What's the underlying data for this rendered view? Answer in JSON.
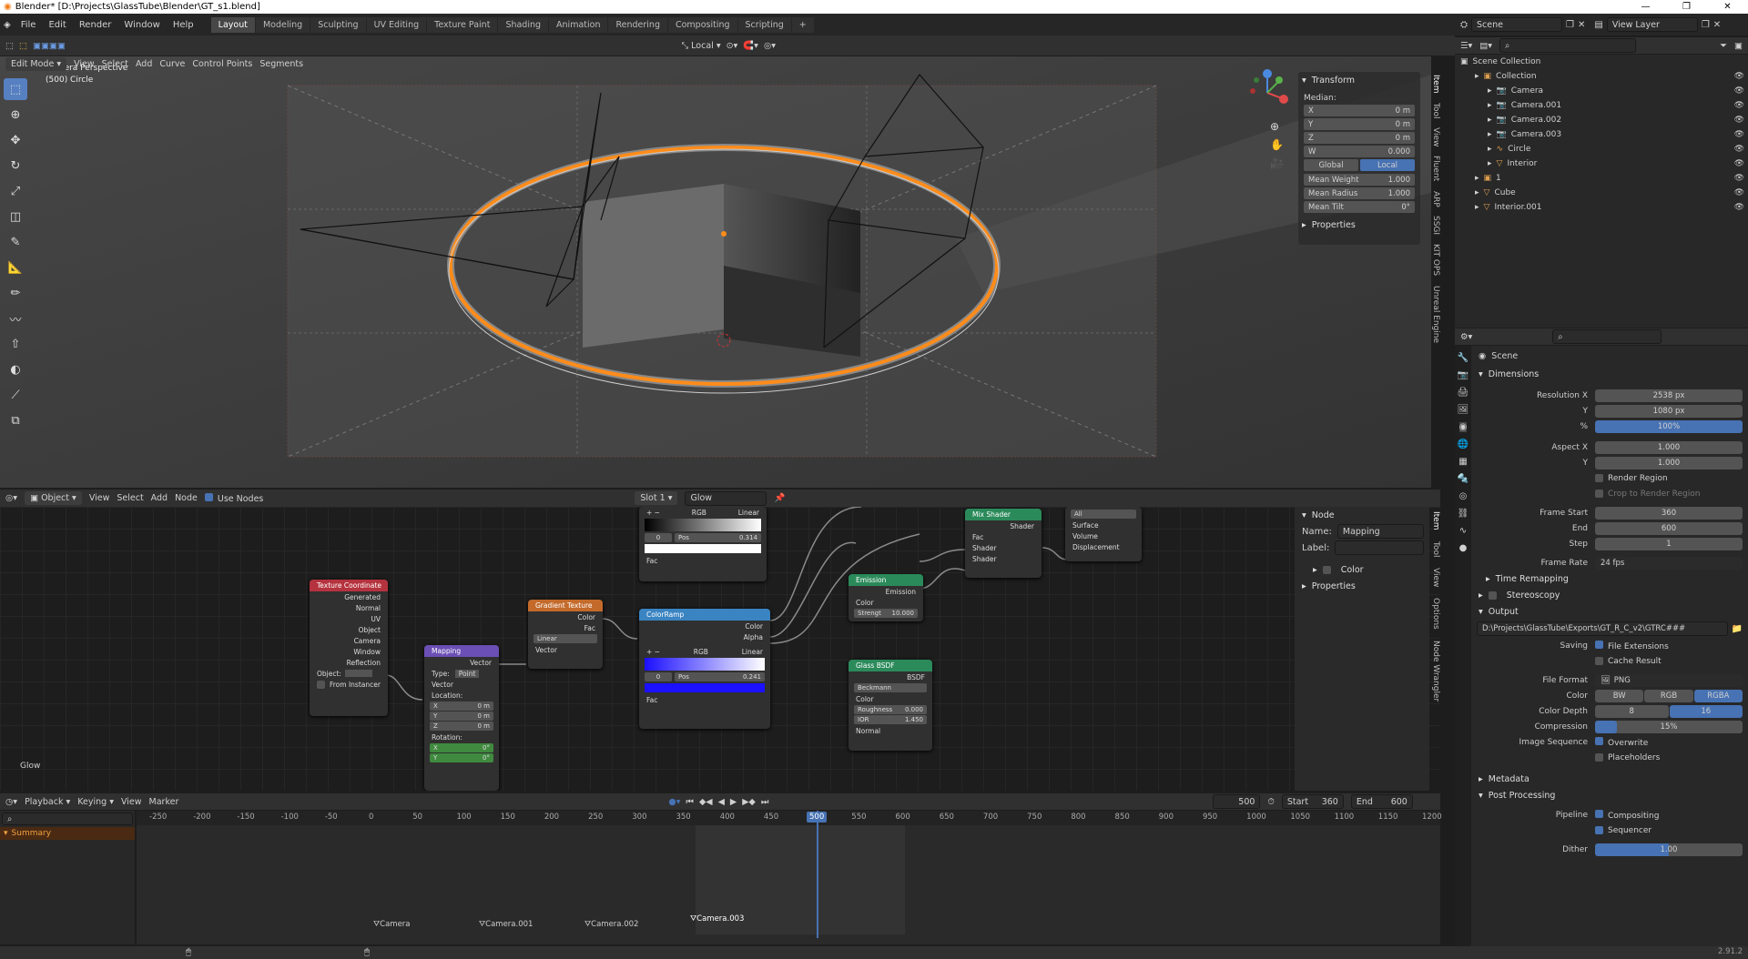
{
  "title": "Blender* [D:\\Projects\\GlassTube\\Blender\\GT_s1.blend]",
  "menu": [
    "File",
    "Edit",
    "Render",
    "Window",
    "Help"
  ],
  "workspaces": [
    "Layout",
    "Modeling",
    "Sculpting",
    "UV Editing",
    "Texture Paint",
    "Shading",
    "Animation",
    "Rendering",
    "Compositing",
    "Scripting"
  ],
  "scene_field": "Scene",
  "view_layer_field": "View Layer",
  "viewport": {
    "header": {
      "mode": "Edit Mode",
      "menus": [
        "View",
        "Select",
        "Add",
        "Curve",
        "Control Points",
        "Segments"
      ],
      "transform_orientation": "Local"
    },
    "overlay_text": [
      "Camera Perspective",
      "(500) Circle"
    ],
    "npanel": {
      "title": "Transform",
      "median_label": "Median:",
      "fields": [
        {
          "label": "X",
          "value": "0 m"
        },
        {
          "label": "Y",
          "value": "0 m"
        },
        {
          "label": "Z",
          "value": "0 m"
        },
        {
          "label": "W",
          "value": "0.000"
        }
      ],
      "space_buttons": [
        "Global",
        "Local"
      ],
      "extra": [
        {
          "label": "Mean Weight",
          "value": "1.000"
        },
        {
          "label": "Mean Radius",
          "value": "1.000"
        },
        {
          "label": "Mean Tilt",
          "value": "0°"
        }
      ],
      "properties": "Properties",
      "tabs": [
        "Item",
        "Tool",
        "View",
        "Fluent",
        "ARP",
        "SSGI",
        "KIT OPS",
        "Unreal Engine"
      ]
    }
  },
  "node_editor": {
    "header": {
      "mode": "Object",
      "menus": [
        "View",
        "Select",
        "Add",
        "Node"
      ],
      "use_nodes": "Use Nodes",
      "slot": "Slot 1",
      "material": "Glow"
    },
    "footer_label": "Glow",
    "nodes": {
      "texcoord": {
        "title": "Texture Coordinate",
        "outputs": [
          "Generated",
          "Normal",
          "UV",
          "Object",
          "Camera",
          "Window",
          "Reflection"
        ],
        "object_label": "Object:",
        "from_instancer": "From Instancer"
      },
      "mapping": {
        "title": "Mapping",
        "out": "Vector",
        "type_label": "Type:",
        "type_value": "Point",
        "in": "Vector",
        "location": "Location:",
        "loc": [
          {
            "label": "X",
            "value": "0 m"
          },
          {
            "label": "Y",
            "value": "0 m"
          },
          {
            "label": "Z",
            "value": "0 m"
          }
        ],
        "rotation": "Rotation:",
        "rot": [
          {
            "label": "X",
            "value": "0°"
          },
          {
            "label": "Y",
            "value": "0°"
          }
        ]
      },
      "gradient": {
        "title": "Gradient Texture",
        "outputs": [
          "Color",
          "Fac"
        ],
        "type": "Linear",
        "in": "Vector"
      },
      "ramp1": {
        "mode": "RGB",
        "interp": "Linear",
        "index": "0",
        "pos_label": "Pos",
        "pos": "0.314",
        "in": "Fac"
      },
      "ramp2": {
        "title": "ColorRamp",
        "outputs": [
          "Color",
          "Alpha"
        ],
        "mode": "RGB",
        "interp": "Linear",
        "index": "0",
        "pos_label": "Pos",
        "pos": "0.241",
        "in": "Fac"
      },
      "emission": {
        "title": "Emission",
        "out": "Emission",
        "in": "Color",
        "strength_label": "Strengt",
        "strength": "10.000"
      },
      "glass": {
        "title": "Glass BSDF",
        "out": "BSDF",
        "dist": "Beckmann",
        "inputs": [
          "Color"
        ],
        "rough_label": "Roughness",
        "rough": "0.000",
        "ior_label": "IOR",
        "ior": "1.450",
        "normal": "Normal"
      },
      "mix": {
        "title": "Mix Shader",
        "out": "Shader",
        "inputs": [
          "Fac",
          "Shader",
          "Shader"
        ]
      },
      "output": {
        "target": "All",
        "inputs": [
          "Surface",
          "Volume",
          "Displacement"
        ]
      }
    },
    "sidebar": {
      "node_title": "Node",
      "name_label": "Name:",
      "name_value": "Mapping",
      "label_label": "Label:",
      "color": "Color",
      "properties": "Properties",
      "tabs": [
        "Item",
        "Tool",
        "View",
        "Options",
        "Node Wrangler"
      ]
    }
  },
  "timeline": {
    "menus": [
      "Playback",
      "Keying",
      "View",
      "Marker"
    ],
    "current_frame": "500",
    "start_label": "Start",
    "start": "360",
    "end_label": "End",
    "end": "600",
    "ticks": [
      "-250",
      "-200",
      "-150",
      "-100",
      "-50",
      "0",
      "50",
      "100",
      "150",
      "200",
      "250",
      "300",
      "350",
      "400",
      "450",
      "500",
      "550",
      "600",
      "650",
      "700",
      "750",
      "800",
      "850",
      "900",
      "950",
      "1000",
      "1050",
      "1100",
      "1150",
      "1200"
    ],
    "summary": "Summary",
    "markers": [
      "Camera",
      "Camera.001",
      "Camera.002",
      "Camera.003"
    ]
  },
  "outliner": {
    "root": "Scene Collection",
    "items": [
      {
        "name": "Collection",
        "indent": 1,
        "icon": "collection-icon"
      },
      {
        "name": "Camera",
        "indent": 2,
        "icon": "camera-icon"
      },
      {
        "name": "Camera.001",
        "indent": 2,
        "icon": "camera-icon"
      },
      {
        "name": "Camera.002",
        "indent": 2,
        "icon": "camera-icon"
      },
      {
        "name": "Camera.003",
        "indent": 2,
        "icon": "camera-icon"
      },
      {
        "name": "Circle",
        "indent": 2,
        "icon": "curve-icon"
      },
      {
        "name": "Interior",
        "indent": 2,
        "icon": "mesh-icon"
      },
      {
        "name": "1",
        "indent": 1,
        "icon": "collection-icon"
      },
      {
        "name": "Cube",
        "indent": 1,
        "icon": "mesh-icon"
      },
      {
        "name": "Interior.001",
        "indent": 1,
        "icon": "mesh-icon"
      }
    ]
  },
  "properties": {
    "context": "Scene",
    "dimensions": "Dimensions",
    "rows1": [
      {
        "label": "Resolution X",
        "value": "2538 px"
      },
      {
        "label": "Y",
        "value": "1080 px"
      },
      {
        "label": "%",
        "value": "100%"
      }
    ],
    "rows2": [
      {
        "label": "Aspect X",
        "value": "1.000"
      },
      {
        "label": "Y",
        "value": "1.000"
      }
    ],
    "render_region": "Render Region",
    "crop": "Crop to Render Region",
    "rows3": [
      {
        "label": "Frame Start",
        "value": "360"
      },
      {
        "label": "End",
        "value": "600"
      },
      {
        "label": "Step",
        "value": "1"
      }
    ],
    "frame_rate_label": "Frame Rate",
    "frame_rate": "24 fps",
    "time_remapping": "Time Remapping",
    "stereoscopy": "Stereoscopy",
    "output": "Output",
    "path": "D:\\Projects\\GlassTube\\Exports\\GT_R_C_v2\\GTRC###",
    "saving_label": "Saving",
    "file_ext": "File Extensions",
    "cache": "Cache Result",
    "file_format_label": "File Format",
    "file_format": "PNG",
    "color_label": "Color",
    "color_opts": [
      "BW",
      "RGB",
      "RGBA"
    ],
    "depth_label": "Color Depth",
    "depth_opts": [
      "8",
      "16"
    ],
    "compression_label": "Compression",
    "compression": "15%",
    "compression_level": 0.15,
    "image_seq_label": "Image Sequence",
    "overwrite": "Overwrite",
    "placeholders": "Placeholders",
    "metadata": "Metadata",
    "post": "Post Processing",
    "pipeline_label": "Pipeline",
    "compositing": "Compositing",
    "sequencer": "Sequencer",
    "dither_label": "Dither",
    "dither": "1.00"
  },
  "version": "2.91.2",
  "colors": {
    "accent": "#4772b3",
    "orange": "#ff8c1a",
    "texcoord": "#b5333e",
    "mapping": "#6b4fb5",
    "gradient": "#c36a2b",
    "colorramp": "#3a84c2",
    "shader": "#2b8a5a"
  }
}
